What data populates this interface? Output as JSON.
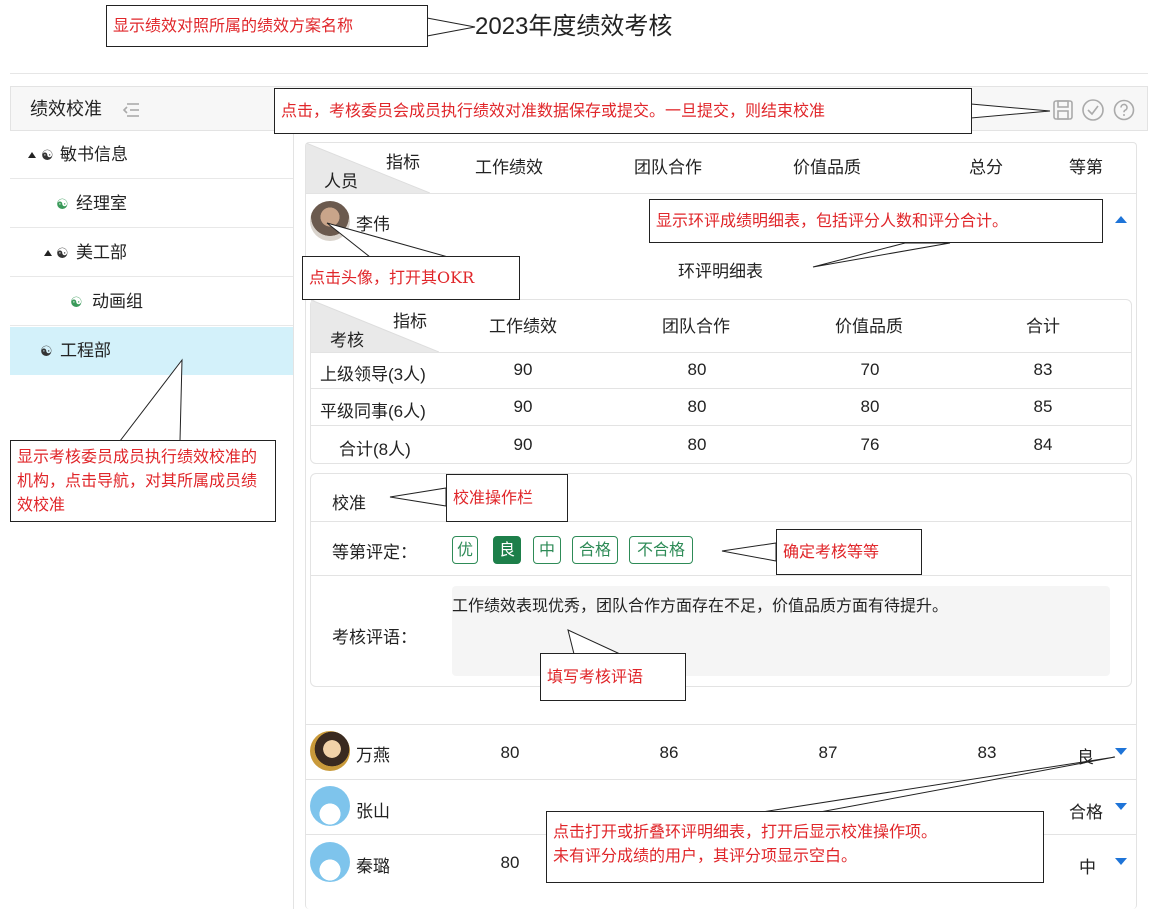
{
  "page": {
    "title": "2023年度绩效考核"
  },
  "panel": {
    "title": "绩效校准",
    "icon_collapse": "collapse-icon",
    "toolbar_icons": [
      "save-icon",
      "check-circle-icon",
      "help-circle-icon"
    ]
  },
  "tree": [
    {
      "label": "敏书信息",
      "expanded": true
    },
    {
      "label": "经理室"
    },
    {
      "label": "美工部",
      "expanded": true
    },
    {
      "label": "动画组"
    },
    {
      "label": "工程部",
      "selected": true
    }
  ],
  "main_table": {
    "corner_top": "指标",
    "corner_bottom": "人员",
    "columns": [
      "工作绩效",
      "团队合作",
      "价值品质",
      "总分",
      "等第"
    ]
  },
  "expanded_person": {
    "name": "李伟",
    "detail_title": "环评明细表",
    "detail_table": {
      "corner_top": "指标",
      "corner_bottom": "考核",
      "columns": [
        "工作绩效",
        "团队合作",
        "价值品质",
        "合计"
      ],
      "rows": [
        {
          "label": "上级领导(3人)",
          "values": [
            "90",
            "80",
            "70",
            "83"
          ]
        },
        {
          "label": "平级同事(6人)",
          "values": [
            "90",
            "80",
            "80",
            "85"
          ]
        },
        {
          "label": "合计(8人)",
          "values": [
            "90",
            "80",
            "76",
            "84"
          ]
        }
      ]
    },
    "calibration": {
      "title": "校准",
      "grade_label": "等第评定：",
      "grades": [
        "优",
        "良",
        "中",
        "合格",
        "不合格"
      ],
      "selected_grade": "良",
      "comment_label": "考核评语：",
      "comment_value": "工作绩效表现优秀，团队合作方面存在不足，价值品质方面有待提升。"
    }
  },
  "people": [
    {
      "name": "万燕",
      "values": [
        "80",
        "86",
        "87",
        "83"
      ],
      "grade": "良"
    },
    {
      "name": "张山",
      "values": [
        "",
        "",
        "",
        ""
      ],
      "grade": "合格"
    },
    {
      "name": "秦璐",
      "values": [
        "80",
        "",
        "",
        ""
      ],
      "grade": "中"
    }
  ],
  "annotations": {
    "scheme": "显示绩效对照所属的绩效方案名称",
    "submit": "点击，考核委员会成员执行绩效对准数据保存或提交。一旦提交，则结束校准",
    "detail": "显示环评成绩明细表，包括评分人数和评分合计。",
    "avatar": "点击头像，打开其OKR",
    "org": "显示考核委员成员执行绩效校准的机构，点击导航，对其所属成员绩效校准",
    "bar": "校准操作栏",
    "grade": "确定考核等等",
    "comment": "填写考核评语",
    "toggle_line1": "点击打开或折叠环评明细表，打开后显示校准操作项。",
    "toggle_line2": "未有评分成绩的用户，其评分项显示空白。"
  },
  "colors": {
    "accent_green": "#1d7f4a",
    "selected_row": "#d3f1fa",
    "caret_blue": "#1e74d8",
    "annotation_red": "#e0262a"
  }
}
